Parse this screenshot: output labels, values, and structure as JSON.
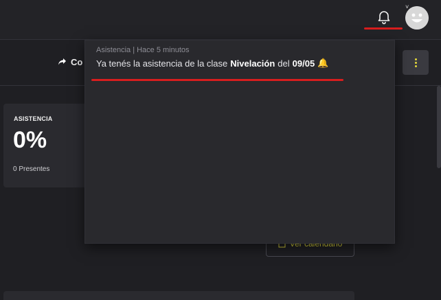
{
  "header": {
    "bell_icon": "bell-icon",
    "avatar_icon": "smiley-avatar",
    "chevron_icon": "chevron-down-icon"
  },
  "toolbar": {
    "share_label": "Co",
    "share_icon": "share-arrow-icon",
    "menu_icon": "kebab-menu-icon"
  },
  "stats_card": {
    "label": "ASISTENCIA",
    "value": "0%",
    "subtext": "0 Presentes"
  },
  "calendar_button": {
    "label": "Ver calendario",
    "icon": "calendar-icon"
  },
  "notifications": [
    {
      "meta": "Asistencia | Hace 5 minutos",
      "text_prefix": "Ya tenés la asistencia de la clase",
      "class_name": "Nivelación",
      "text_middle": "del",
      "date": "09/05",
      "emoji": "🔔"
    }
  ],
  "colors": {
    "accent_yellow": "#e4d83a",
    "highlight_red": "#d81e1e",
    "background": "#1f1f23",
    "panel": "#29292d"
  }
}
